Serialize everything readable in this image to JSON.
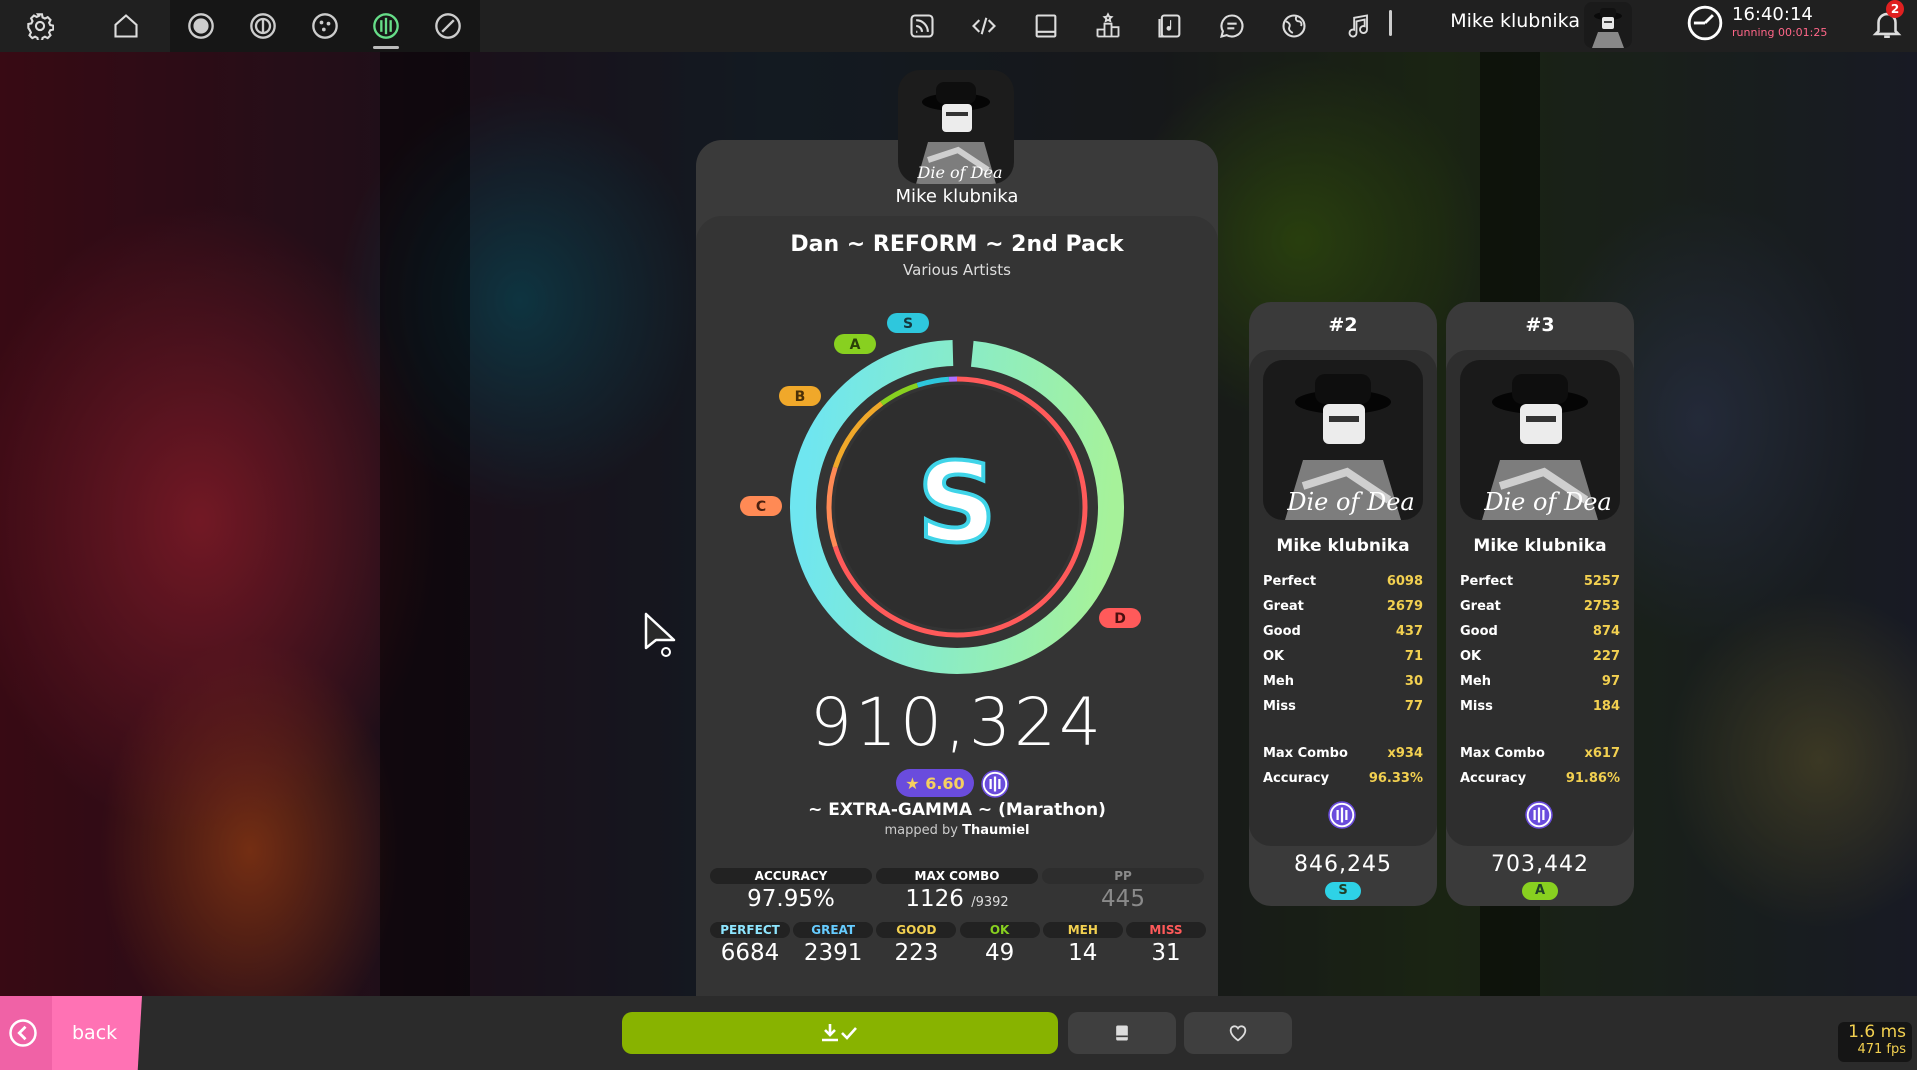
{
  "topbar": {
    "username": "Mike klubnika",
    "clock_time": "16:40:14",
    "clock_running": "running 00:01:25",
    "notification_count": "2",
    "left_icons": [
      "gear-icon",
      "home-icon",
      "osu-ruleset-icon",
      "taiko-ruleset-icon",
      "catch-ruleset-icon",
      "mania-ruleset-icon",
      "custom-ruleset-icon"
    ],
    "right_icons": [
      "rss-icon",
      "code-icon",
      "book-icon",
      "rankings-icon",
      "beatmap-listing-icon",
      "chat-icon",
      "globe-icon",
      "music-icon"
    ]
  },
  "user": {
    "name": "Mike klubnika",
    "avatar_caption": "Die of Dea"
  },
  "beatmap": {
    "title": "Dan ~ REFORM ~ 2nd Pack",
    "artist": "Various Artists",
    "difficulty": "~ EXTRA-GAMMA ~ (Marathon)",
    "mapped_by_prefix": "mapped by",
    "mapper": "Thaumiel",
    "star_rating": "★ 6.60"
  },
  "score": {
    "grade": "S",
    "total": "910,324",
    "accuracy_fraction": 0.9795,
    "grade_labels": {
      "s": "S",
      "a": "A",
      "b": "B",
      "c": "C",
      "d": "D"
    },
    "stats_top": [
      {
        "label": "ACCURACY",
        "value": "97.95%"
      },
      {
        "label": "MAX COMBO",
        "value": "1126",
        "suffix": "/9392"
      },
      {
        "label": "PP",
        "value": "445"
      }
    ],
    "stats_bottom": [
      {
        "label": "PERFECT",
        "value": "6684",
        "color": "#8ee6ff"
      },
      {
        "label": "GREAT",
        "value": "2391",
        "color": "#66ccff"
      },
      {
        "label": "GOOD",
        "value": "223",
        "color": "#f2d050"
      },
      {
        "label": "OK",
        "value": "49",
        "color": "#88d020"
      },
      {
        "label": "MEH",
        "value": "14",
        "color": "#f2d050"
      },
      {
        "label": "MISS",
        "value": "31",
        "color": "#ff5a5a"
      }
    ]
  },
  "leaderboard": [
    {
      "position": "#2",
      "user": "Mike klubnika",
      "stats": [
        {
          "k": "Perfect",
          "v": "6098"
        },
        {
          "k": "Great",
          "v": "2679"
        },
        {
          "k": "Good",
          "v": "437"
        },
        {
          "k": "OK",
          "v": "71"
        },
        {
          "k": "Meh",
          "v": "30"
        },
        {
          "k": "Miss",
          "v": "77"
        }
      ],
      "max_combo_label": "Max Combo",
      "max_combo": "x934",
      "accuracy_label": "Accuracy",
      "accuracy": "96.33%",
      "score": "846,245",
      "grade": "S",
      "grade_color": "#2ed2e6"
    },
    {
      "position": "#3",
      "user": "Mike klubnika",
      "stats": [
        {
          "k": "Perfect",
          "v": "5257"
        },
        {
          "k": "Great",
          "v": "2753"
        },
        {
          "k": "Good",
          "v": "874"
        },
        {
          "k": "OK",
          "v": "227"
        },
        {
          "k": "Meh",
          "v": "97"
        },
        {
          "k": "Miss",
          "v": "184"
        }
      ],
      "max_combo_label": "Max Combo",
      "max_combo": "x617",
      "accuracy_label": "Accuracy",
      "accuracy": "91.86%",
      "score": "703,442",
      "grade": "A",
      "grade_color": "#88d020"
    }
  ],
  "bottombar": {
    "back_label": "back",
    "download_icon": "download-check-icon",
    "collection_icon": "collection-icon",
    "favourite_icon": "heart-icon",
    "frame_time": "1.6 ms",
    "fps": "471 fps"
  },
  "colors": {
    "accent_green": "#88b300",
    "back_pink": "#ff72b4",
    "stat_yellow": "#f2d050",
    "ruleset_purple": "#6a4cdd"
  }
}
